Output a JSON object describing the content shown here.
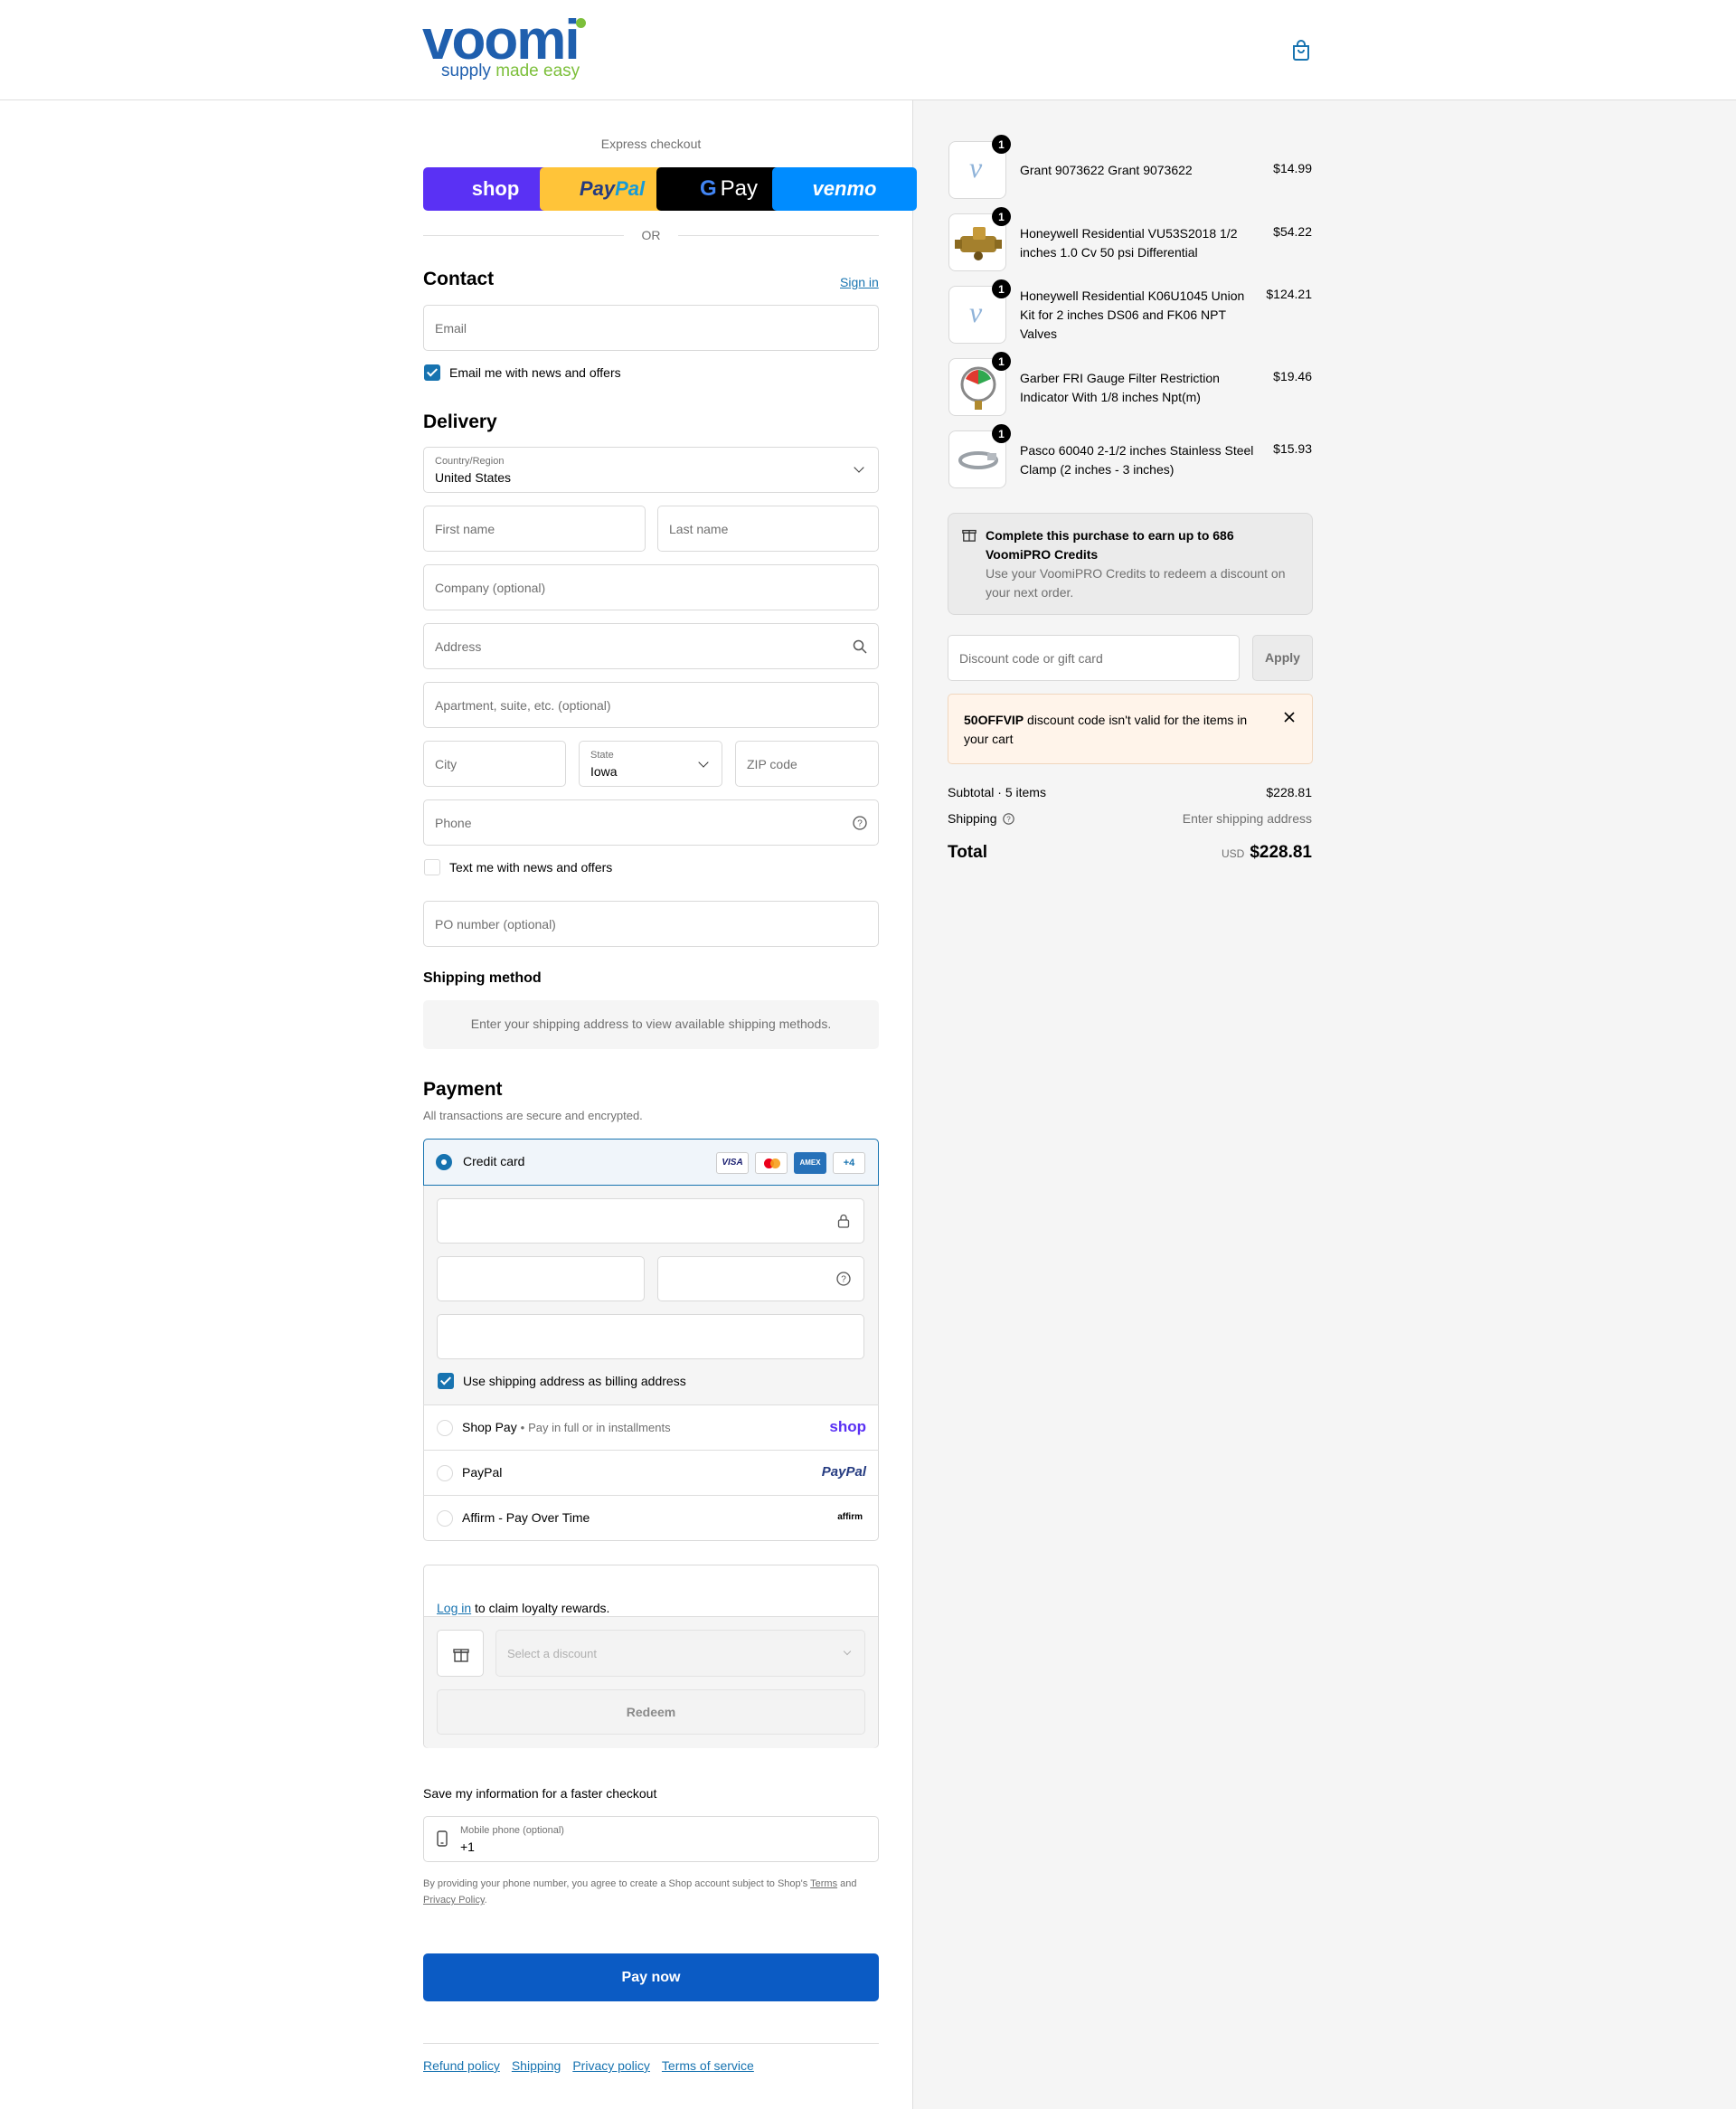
{
  "header": {
    "logo_text": "voomi",
    "logo_tagline_a": "supply",
    "logo_tagline_b": "made easy",
    "cart_icon": "shopping-bag-icon"
  },
  "express": {
    "title": "Express checkout",
    "shop_label": "shop",
    "paypal_label_a": "Pay",
    "paypal_label_b": "Pal",
    "gpay_label": "Pay",
    "venmo_label": "venmo",
    "or_label": "OR"
  },
  "contact": {
    "title": "Contact",
    "sign_in": "Sign in",
    "email_placeholder": "Email",
    "news_label": "Email me with news and offers"
  },
  "delivery": {
    "title": "Delivery",
    "country_label": "Country/Region",
    "country_value": "United States",
    "first_name": "First name",
    "last_name": "Last name",
    "company": "Company (optional)",
    "address": "Address",
    "apartment": "Apartment, suite, etc. (optional)",
    "city": "City",
    "state_label": "State",
    "state_value": "Iowa",
    "zip": "ZIP code",
    "phone": "Phone",
    "text_label": "Text me with news and offers",
    "po_number": "PO number (optional)"
  },
  "shipping_method": {
    "title": "Shipping method",
    "message": "Enter your shipping address to view available shipping methods."
  },
  "payment": {
    "title": "Payment",
    "subtitle": "All transactions are secure and encrypted.",
    "credit_card_label": "Credit card",
    "card_brands": [
      "VISA",
      "Mastercard",
      "AMEX"
    ],
    "more_brands": "+4",
    "billing_label": "Use shipping address as billing address",
    "shop_pay_label": "Shop Pay",
    "shop_pay_sub": "Pay in full or in installments",
    "shop_pay_logo": "shop",
    "paypal_label": "PayPal",
    "paypal_logo": "PayPal",
    "affirm_label": "Affirm - Pay Over Time",
    "affirm_logo": "affirm"
  },
  "loyalty": {
    "login_link": "Log in",
    "login_rest": "to claim loyalty rewards.",
    "select_placeholder": "Select a discount",
    "redeem": "Redeem"
  },
  "save_info": {
    "title": "Save my information for a faster checkout",
    "mobile_label": "Mobile phone (optional)",
    "mobile_value": "+1",
    "legal_a": "By providing your phone number, you agree to create a Shop account subject to Shop's",
    "terms": "Terms",
    "legal_and": "and",
    "privacy": "Privacy Policy",
    "legal_end": "."
  },
  "pay_now": "Pay now",
  "footer": [
    "Refund policy",
    "Shipping",
    "Privacy policy",
    "Terms of service"
  ],
  "order": {
    "items": [
      {
        "name": "Grant 9073622 Grant 9073622",
        "price": "$14.99",
        "qty": "1"
      },
      {
        "name": "Honeywell Residential VU53S2018 1/2 inches 1.0 Cv 50 psi Differential",
        "price": "$54.22",
        "qty": "1"
      },
      {
        "name": "Honeywell Residential K06U1045 Union Kit for 2 inches DS06 and FK06 NPT Valves",
        "price": "$124.21",
        "qty": "1"
      },
      {
        "name": "Garber FRI Gauge Filter Restriction Indicator With 1/8 inches Npt(m)",
        "price": "$19.46",
        "qty": "1"
      },
      {
        "name": "Pasco 60040 2-1/2 inches Stainless Steel Clamp (2 inches - 3 inches)",
        "price": "$15.93",
        "qty": "1"
      }
    ],
    "credits_title": "Complete this purchase to earn up to 686 VoomiPRO Credits",
    "credits_sub": "Use your VoomiPRO Credits to redeem a discount on your next order.",
    "discount_placeholder": "Discount code or gift card",
    "apply": "Apply",
    "error_code": "50OFFVIP",
    "error_rest": "discount code isn't valid for the items in your cart",
    "subtotal_label": "Subtotal · 5 items",
    "subtotal_value": "$228.81",
    "shipping_label": "Shipping",
    "shipping_value": "Enter shipping address",
    "total_label": "Total",
    "currency": "USD",
    "total_value": "$228.81"
  },
  "colors": {
    "brand_blue": "#1f5fae",
    "brand_green": "#7cbf3a",
    "accent": "#1773b0",
    "pay_button": "#0b5bc4",
    "shop_purple": "#5a31f4",
    "paypal_yellow": "#ffc439",
    "venmo_blue": "#008cff",
    "error_bg": "#fff4ea"
  }
}
